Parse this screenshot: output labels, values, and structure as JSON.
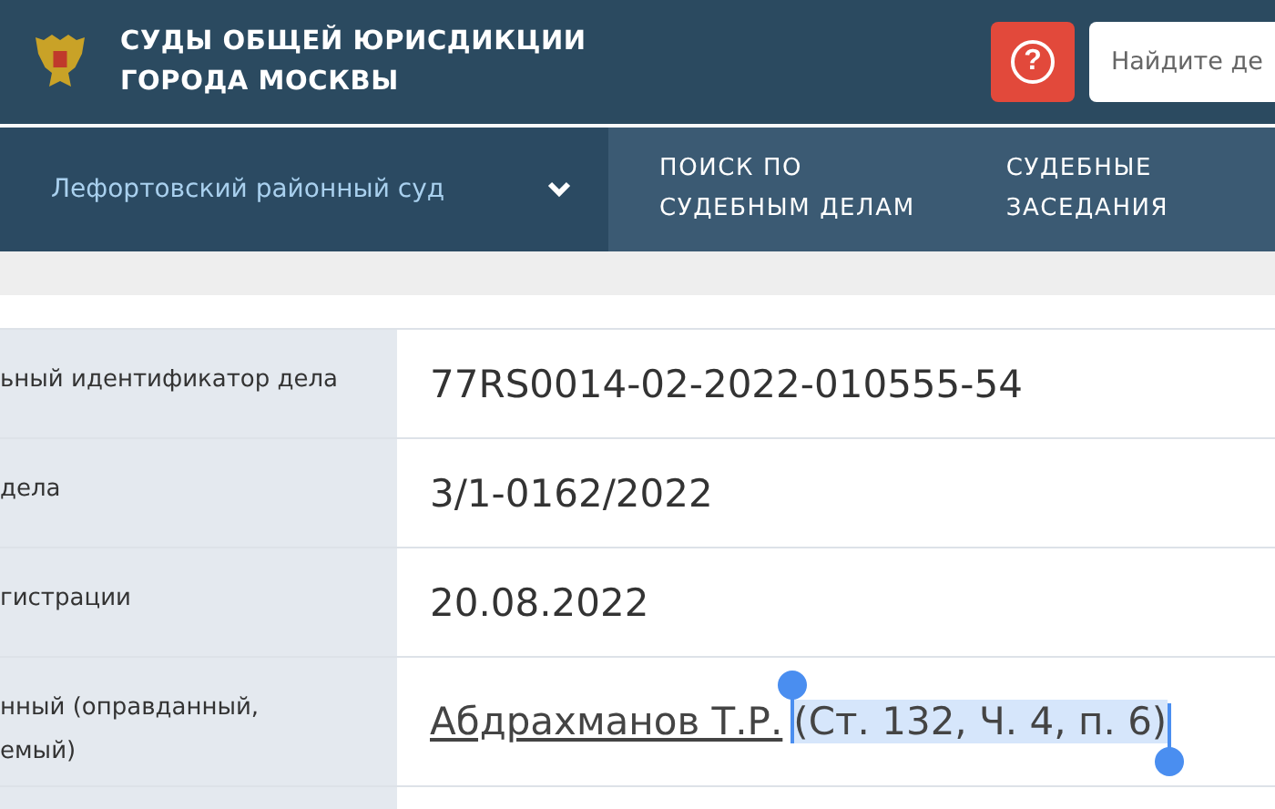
{
  "header": {
    "title_lines": [
      "СУДЫ ОБЩЕЙ ЮРИСДИКЦИИ",
      "ГОРОДА МОСКВЫ"
    ],
    "help": "?",
    "search": {
      "placeholder": "Найдите де"
    }
  },
  "nav": {
    "court": "Лефортовский районный суд",
    "items": [
      {
        "lines": [
          "ПОИСК ПО",
          "СУДЕБНЫМ ДЕЛАМ"
        ]
      },
      {
        "lines": [
          "СУДЕБНЫЕ",
          "ЗАСЕДАНИЯ"
        ]
      }
    ]
  },
  "rows": [
    {
      "label": [
        "ьный идентификатор дела"
      ],
      "value": "77RS0014-02-2022-010555-54"
    },
    {
      "label": [
        "дела"
      ],
      "value": "3/1-0162/2022"
    },
    {
      "label": [
        "гистрации"
      ],
      "value": "20.08.2022"
    },
    {
      "label": [
        "нный (оправданный,",
        "емый)"
      ],
      "value": "Абдрахманов Т.Р.",
      "kind": "link",
      "note": "(Ст. 132, Ч. 4, п. 6)",
      "selected": true
    }
  ]
}
